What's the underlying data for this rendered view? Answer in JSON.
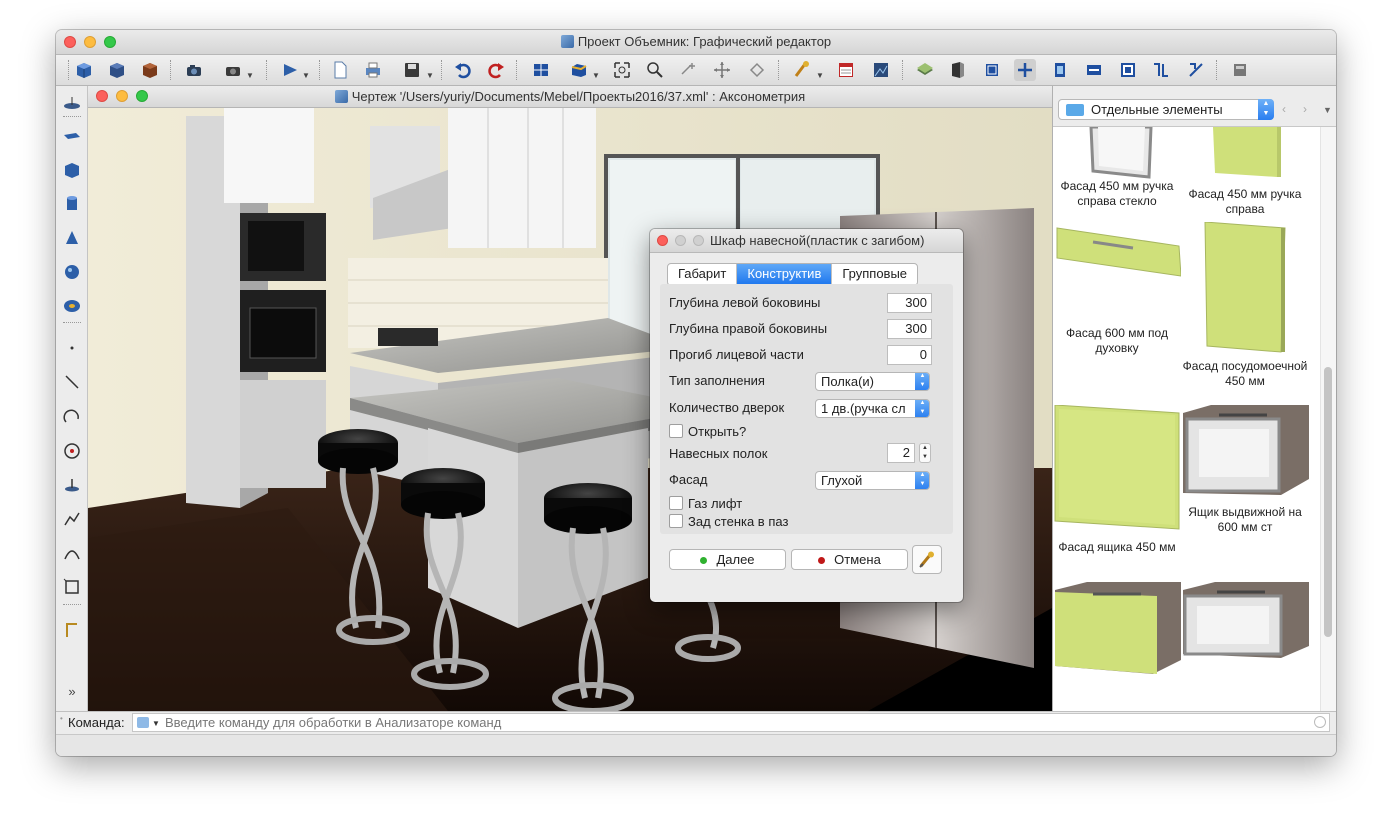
{
  "main_window": {
    "title": "Проект Объемник: Графический редактор"
  },
  "toolbar": {
    "icons": [
      "cube-blue-icon",
      "cube-dark-icon",
      "cube-brown-icon",
      "camera-icon",
      "camera-dropdown-icon",
      "play-icon",
      "new-file-icon",
      "print-icon",
      "save-icon",
      "undo-icon",
      "redo-icon",
      "view-layout-icon",
      "box-view-icon",
      "zoom-fit-icon",
      "zoom-icon",
      "move-icon",
      "pan-icon",
      "rotate-icon",
      "paint-brush-icon",
      "calendar-icon",
      "render-icon",
      "layers-icon",
      "panel-icon",
      "cube-frame-icon",
      "add-element-icon",
      "tool-a-icon",
      "tool-b-icon",
      "tool-c-icon",
      "tool-d-icon",
      "tool-e-icon",
      "storage-icon"
    ]
  },
  "left_tools": {
    "icons": [
      "platform-icon",
      "plank-icon",
      "box-icon",
      "cylinder-icon",
      "cone-icon",
      "sphere-icon",
      "torus-icon",
      "point-icon",
      "line-icon",
      "arc-icon",
      "circle-icon",
      "anchor-icon",
      "polyline-icon",
      "curve-icon",
      "rectangle-icon",
      "dimension-icon",
      "expand-icon"
    ]
  },
  "drawing_window": {
    "title": "Чертеж '/Users/yuriy/Documents/Mebel/Проекты2016/37.xml' : Аксонометрия"
  },
  "library": {
    "category": "Отдельные элементы",
    "items": [
      {
        "label": "Фасад 450 мм ручка справа стекло",
        "color": "#d8d8d8"
      },
      {
        "label": "Фасад 450 мм ручка справа",
        "color": "#cfe07a"
      },
      {
        "label": "Фасад 600 мм под духовку",
        "color": "#cfe07a"
      },
      {
        "label": "Фасад посудомоечной 450 мм",
        "color": "#cfe07a"
      },
      {
        "label": "Фасад ящика 450 мм",
        "color": "#cfe07a"
      },
      {
        "label": "Ящик выдвижной на 600 мм ст",
        "color": "#7a6e66"
      },
      {
        "label": "",
        "color": "#cfe07a"
      },
      {
        "label": "",
        "color": "#7a6e66"
      }
    ]
  },
  "command": {
    "label": "Команда:",
    "placeholder": "Введите команду для обработки в Анализаторе команд"
  },
  "dialog": {
    "title": "Шкаф навесной(пластик с загибом)",
    "tabs": [
      "Габарит",
      "Конструктив",
      "Групповые"
    ],
    "active_tab": "Конструктив",
    "fields": {
      "left_depth_label": "Глубина левой боковины",
      "left_depth_value": "300",
      "right_depth_label": "Глубина правой боковины",
      "right_depth_value": "300",
      "front_bend_label": "Прогиб лицевой части",
      "front_bend_value": "0",
      "fill_type_label": "Тип заполнения",
      "fill_type_value": "Полка(и)",
      "doors_label": "Количество дверок",
      "doors_value": "1 дв.(ручка сл",
      "open_label": "Открыть?",
      "shelves_label": "Навесных полок",
      "shelves_value": "2",
      "facade_label": "Фасад",
      "facade_value": "Глухой",
      "gas_lift_label": "Газ лифт",
      "back_wall_label": "Зад стенка в паз"
    },
    "buttons": {
      "next_label": "Далее",
      "cancel_label": "Отмена"
    },
    "colors": {
      "next_dot": "#2fb12f",
      "cancel_dot": "#c01818",
      "tab_active": "#1d76ee"
    }
  }
}
